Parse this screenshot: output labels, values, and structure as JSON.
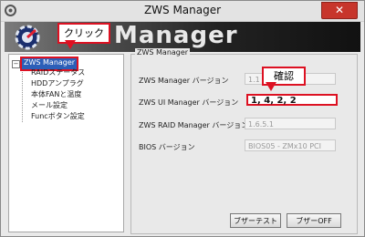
{
  "window": {
    "title": "ZWS Manager",
    "close_label": "✕"
  },
  "banner": {
    "text": "Manager"
  },
  "callouts": {
    "click": "クリック",
    "confirm": "確認"
  },
  "tree": {
    "root": "ZWS Manager",
    "expander": "−",
    "items": [
      "RAIDステータス",
      "HDDアンプラグ",
      "本体FANと温度",
      "メール設定",
      "Funcボタン設定"
    ]
  },
  "panel": {
    "group_title": "ZWS Manager",
    "rows": [
      {
        "label": "ZWS Manager バージョン",
        "value": "1.1"
      },
      {
        "label": "ZWS UI Manager バージョン",
        "value": "1, 4, 2, 2"
      },
      {
        "label": "ZWS RAID Manager バージョン",
        "value": "1.6.5.1"
      },
      {
        "label": "BIOS バージョン",
        "value": "BIOS05 - ZMx10 PCI"
      }
    ],
    "buttons": {
      "buzzer_test": "ブザーテスト",
      "buzzer_off": "ブザーOFF"
    }
  },
  "colors": {
    "highlight_red": "#dd1122",
    "selection_blue": "#2c5fb8",
    "close_red": "#c7352b"
  }
}
